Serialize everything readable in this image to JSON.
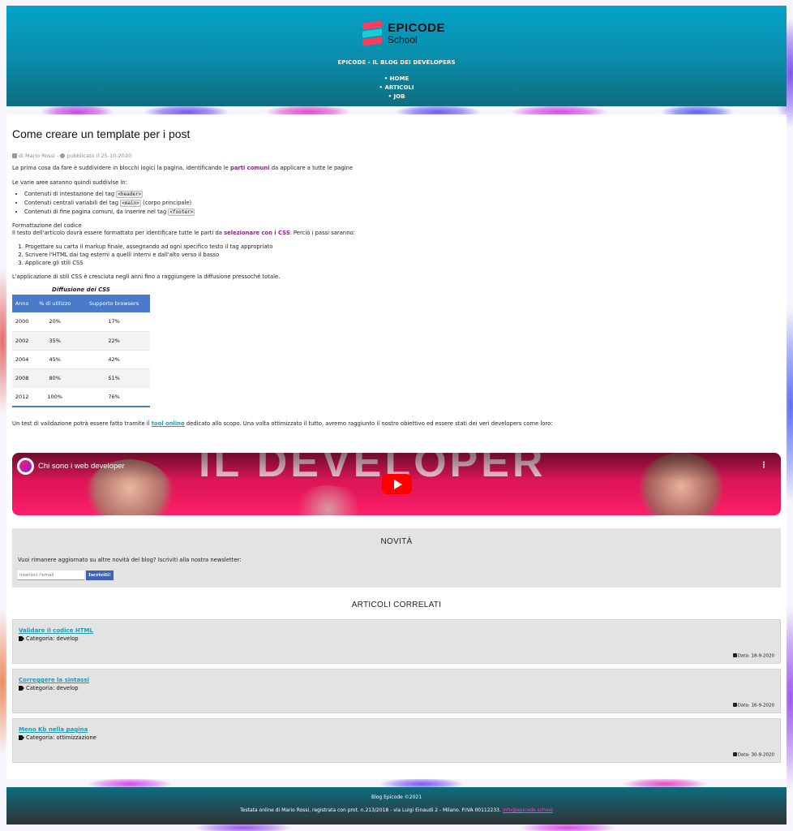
{
  "header": {
    "logo_brand": "EPICODE",
    "logo_sub": "School",
    "tagline": "EPICODE - IL BLOG DEI DEVELOPERS",
    "nav": [
      {
        "label": "HOME"
      },
      {
        "label": "ARTICOLI"
      },
      {
        "label": "JOB"
      }
    ]
  },
  "article": {
    "title": "Come creare un template per i post",
    "meta": {
      "author": "di Mario Rossi",
      "separator": "-",
      "published": "pubblicato il 25-10-2020"
    },
    "intro_before": "La prima cosa da fare è suddividere in blocchi logici la pagina, identificando le ",
    "intro_highlight": "parti comuni",
    "intro_after": " da applicare a tutte le pagine",
    "areas_intro": "Le varie aree saranno quindi suddivise in:",
    "areas": [
      {
        "before": "Contenuti di intestazione del tag ",
        "code": "<header>",
        "after": ""
      },
      {
        "before": "Contenuti centrali variabili del tag ",
        "code": "<main>",
        "after": " (corpo principale)"
      },
      {
        "before": "Contenuti di fine pagina comuni, da inserire nel tag ",
        "code": "<footer>",
        "after": ""
      }
    ],
    "format_heading": "Formattazione del codice",
    "format_before": "Il testo dell'articolo dovrà essere formattato per identificare tutte le parti da ",
    "format_highlight": "selezionare con i CSS",
    "format_after": ". Perciò i passi saranno:",
    "steps": [
      "Progettare su carta il markup finale, assegnando ad ogni specifico testo il tag appropriato",
      "Scrivere l'HTML dai tag esterni a quelli interni e dall'alto verso il basso",
      "Applicare gli stili CSS"
    ],
    "css_growth": "L'applicazione di stili CSS è cresciuta negli anni fino a raggiungere la diffusione pressoché totale.",
    "table": {
      "caption": "Diffusione dei CSS",
      "headers": [
        "Anno",
        "% di utilizzo",
        "Supporto browsers"
      ],
      "rows": [
        [
          "2000",
          "20%",
          "17%"
        ],
        [
          "2002",
          "35%",
          "22%"
        ],
        [
          "2004",
          "45%",
          "42%"
        ],
        [
          "2008",
          "80%",
          "51%"
        ],
        [
          "2012",
          "100%",
          "76%"
        ]
      ]
    },
    "validation_before": "Un test di validazione potrà essere fatto tramite il ",
    "validation_link": "tool online",
    "validation_after": " dedicato allo scopo. Una volta ottimizzato il tutto, avremo raggiunto il nostro obiettivo ed essere stati dei veri developers come loro:",
    "video": {
      "title": "Chi sono i web developer",
      "menu": "⋮"
    }
  },
  "newsletter": {
    "heading": "NOVITÀ",
    "text": "Vuoi rimanere aggiornato su altre novità del blog? Iscriviti alla nostra newsletter:",
    "placeholder": "inserisci l'email",
    "button": "Iscriviti!"
  },
  "related": {
    "heading": "ARTICOLI CORRELATI",
    "items": [
      {
        "title": "Validare il codice HTML",
        "category": "Categoria: develop",
        "date": "Data: 18-9-2020"
      },
      {
        "title": "Correggere la sintassi",
        "category": "Categoria: develop",
        "date": "Data: 16-9-2020"
      },
      {
        "title": "Meno Kb nella pagina",
        "category": "Categoria: ottimizzazione",
        "date": "Data: 30-9-2020"
      }
    ]
  },
  "footer": {
    "copyright": "Blog Epicode ©2021",
    "legal": "Testata online di Mario Rossi, registrata con prot. n.213/2018 - via Luigi Einaudi 2 - Milano. P.IVA 00112233. ",
    "email": "info@epicode.school"
  },
  "colors": {
    "header_top": "#05a3c9",
    "accent_purple": "#9c1b8f",
    "link_teal": "#1b9cb8",
    "table_blue": "#4b7ac9",
    "email_pink": "#ff3fd8"
  }
}
